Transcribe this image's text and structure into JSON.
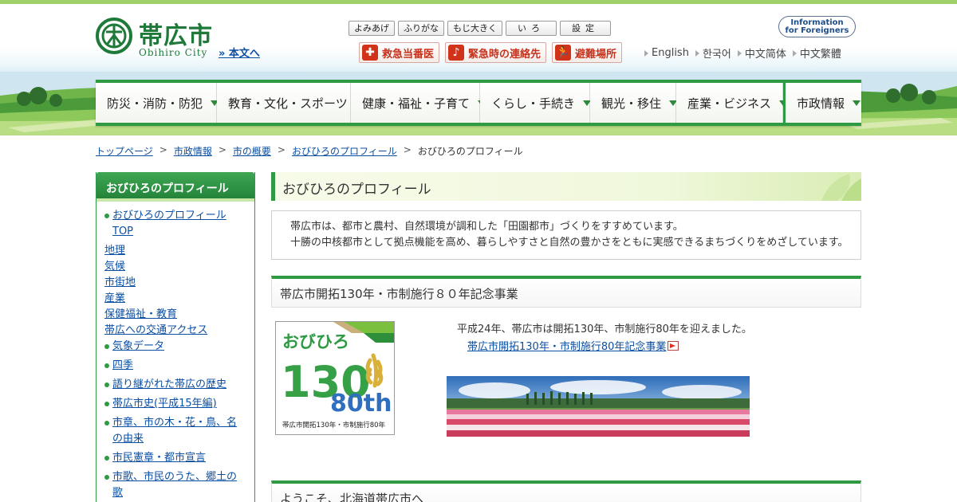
{
  "header": {
    "city_name_jp": "帯広市",
    "city_name_en": "Obihiro City",
    "skip_link": "» 本文へ",
    "tools": [
      "よみあげ",
      "ふりがな",
      "もじ大きく",
      "いろ",
      "設定"
    ],
    "foreign_line1": "Information",
    "foreign_line2": "for Foreigners",
    "emergency": [
      {
        "label": "救急当番医",
        "icon": "medical-cross-icon"
      },
      {
        "label": "緊急時の連絡先",
        "icon": "phone-icon"
      },
      {
        "label": "避難場所",
        "icon": "evacuation-icon"
      }
    ],
    "languages": [
      "English",
      "한국어",
      "中文简体",
      "中文繁體"
    ]
  },
  "nav": {
    "items": [
      "防災・消防・防犯",
      "教育・文化・スポーツ",
      "健康・福祉・子育て",
      "くらし・手続き",
      "観光・移住",
      "産業・ビジネス",
      "市政情報"
    ]
  },
  "breadcrumb": {
    "items": [
      "トップページ",
      "市政情報",
      "市の概要",
      "おびひろのプロフィール"
    ],
    "current": "おびひろのプロフィール",
    "separator": ">"
  },
  "sidebar": {
    "title": "おびひろのプロフィール",
    "items": [
      "おびひろのプロフィール",
      "TOP",
      "地理",
      "気候",
      "市街地",
      "産業",
      "保健福祉・教育",
      "帯広への交通アクセス",
      "気象データ",
      "四季",
      "語り継がれた帯広の歴史",
      "帯広市史(平成15年編)",
      "市章、市の木・花・鳥、名",
      "の由来",
      "市民憲章・都市宣言",
      "市歌、市民のうた、郷土の",
      "歌"
    ]
  },
  "main": {
    "title": "おびひろのプロフィール",
    "intro_line1": "帯広市は、都市と農村、自然環境が調和した「田園都市」づくりをすすめています。",
    "intro_line2": "十勝の中核都市として拠点機能を高め、暮らしやすさと自然の豊かさをともに実感できるまちづくりをめざしています。",
    "section1_title": "帯広市開拓130年・市制施行８０年記念事業",
    "anniv_logo_text_top": "おびひろ",
    "anniv_logo_130": "130",
    "anniv_logo_80th": "80th",
    "anniv_logo_caption": "帯広市開拓130年・市制施行80年",
    "anniv_text": "平成24年、帯広市は開拓130年、市制施行80年を迎えました。",
    "anniv_link": "帯広市開拓130年・市制施行80年記念事業",
    "section2_title": "ようこそ、北海道帯広市へ"
  },
  "colors": {
    "accent_green": "#2e9a43",
    "link_blue": "#0b4fa3",
    "emergency_red": "#d0321a"
  }
}
